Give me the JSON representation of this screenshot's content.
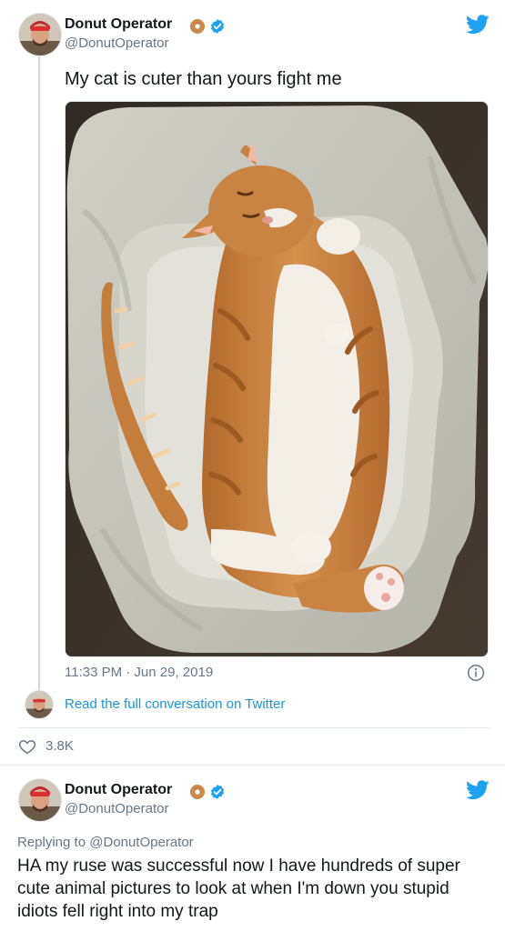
{
  "colors": {
    "twitter_blue": "#1da1f2",
    "link_blue": "#1b95e0",
    "secondary_text": "#657786",
    "divider": "#e1e8ed"
  },
  "tweet1": {
    "display_name": "Donut Operator",
    "handle": "@DonutOperator",
    "text": "My cat is cuter than yours fight me",
    "timestamp": "11:33 PM · Jun 29, 2019",
    "read_conversation": "Read the full conversation on Twitter",
    "likes": "3.8K",
    "icons": [
      "twitter-bird-icon",
      "verified-icon",
      "donut-emoji-icon",
      "info-icon",
      "heart-icon"
    ]
  },
  "tweet2": {
    "display_name": "Donut Operator",
    "handle": "@DonutOperator",
    "replying_to": "Replying to @DonutOperator",
    "text": "HA my ruse was successful now I have hundreds of super cute animal pictures to look at when I'm down you stupid idiots fell right into my trap"
  }
}
